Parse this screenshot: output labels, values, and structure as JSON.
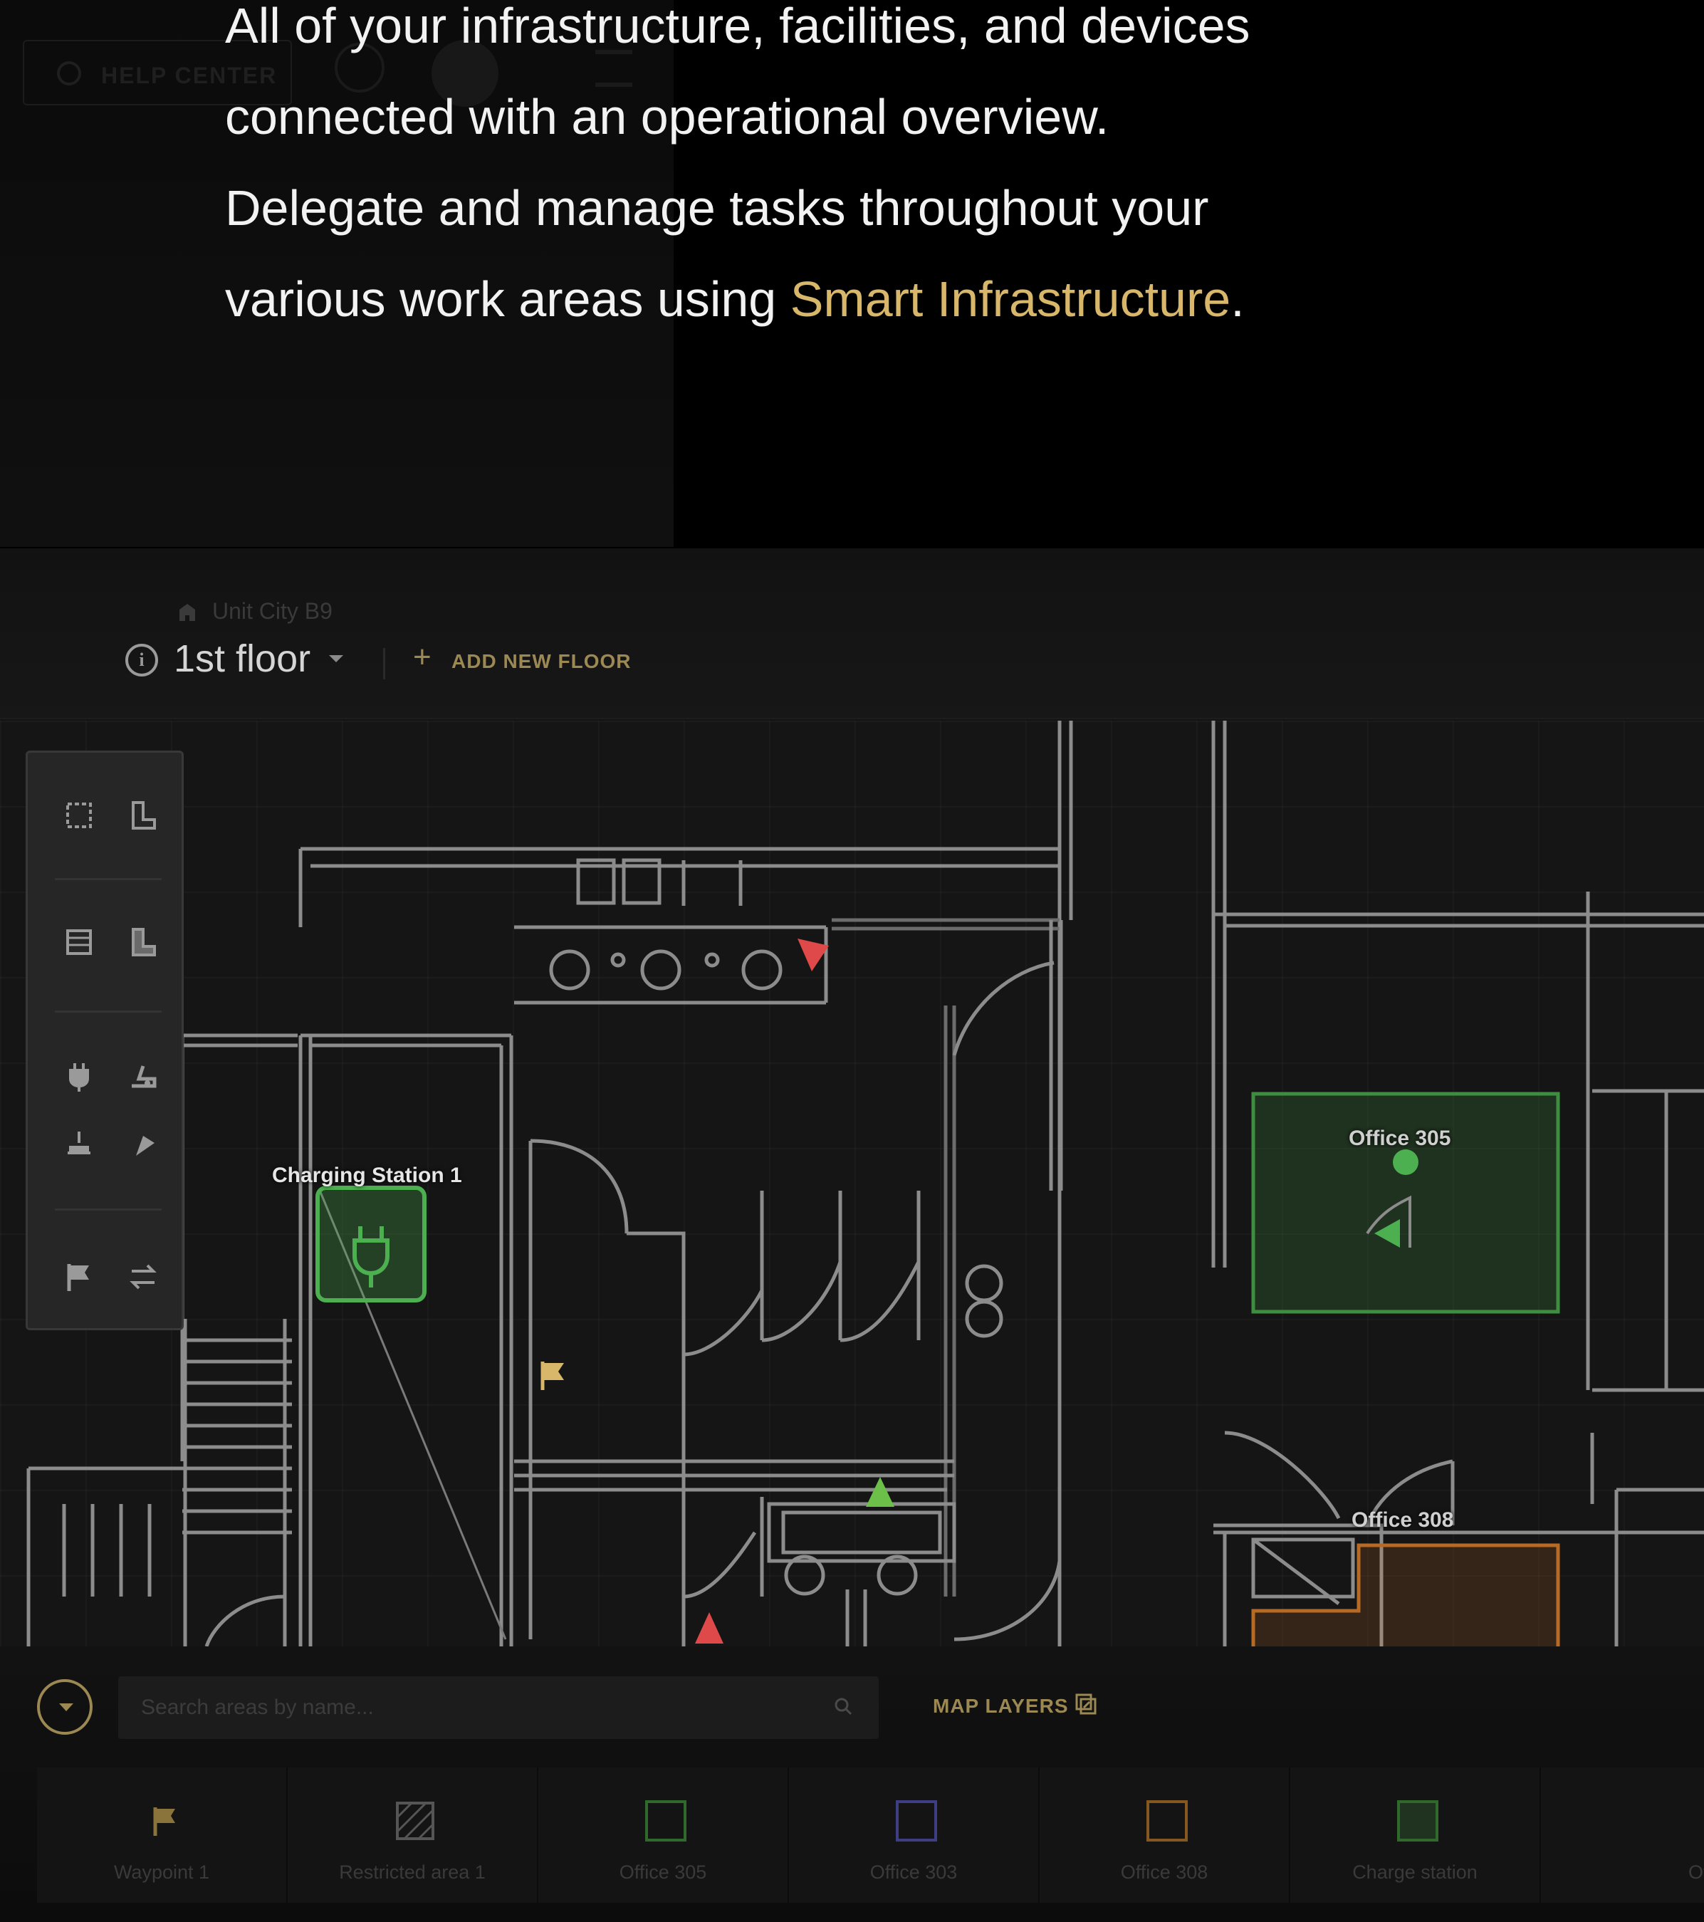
{
  "hero": {
    "line1": "All of your infrastructure, facilities, and devices",
    "line2": "connected with an operational overview.",
    "line3": "Delegate and manage tasks throughout your",
    "line4_prefix": "various work areas using ",
    "line4_accent": "Smart Infrastructure",
    "line4_suffix": "."
  },
  "ghost": {
    "help_center": "HELP CENTER"
  },
  "header": {
    "building": "Unit City B9",
    "floor": "1st floor",
    "add_floor": "ADD NEW FLOOR"
  },
  "map": {
    "labels": {
      "charging_station": "Charging Station 1",
      "office_305": "Office 305",
      "office_308": "Office 308"
    }
  },
  "toolbar": {
    "tools": [
      "rect-area-icon",
      "polygon-area-icon",
      "restricted-rect-icon",
      "restricted-polygon-icon",
      "charger-icon",
      "robot-icon",
      "dock-icon",
      "location-pin-icon",
      "waypoint-flag-icon",
      "route-swap-icon"
    ]
  },
  "bottom": {
    "search_placeholder": "Search areas by name...",
    "map_layers": "MAP LAYERS",
    "layers": [
      {
        "label": "Waypoint 1",
        "kind": "flag",
        "color": "#b89a4a"
      },
      {
        "label": "Restricted area 1",
        "kind": "hatch",
        "color": "#6a6a6a"
      },
      {
        "label": "Office 305",
        "kind": "square",
        "color": "#3c7a34"
      },
      {
        "label": "Office 303",
        "kind": "square",
        "color": "#4b4b9a"
      },
      {
        "label": "Office 308",
        "kind": "square",
        "color": "#9a6a2c"
      },
      {
        "label": "Charge station",
        "kind": "charger",
        "color": "#3c7a34"
      },
      {
        "label": "Office",
        "kind": "square",
        "color": "#8a2a2a"
      }
    ]
  },
  "colors": {
    "accent": "#d8b66a",
    "green": "#4caf50",
    "orange": "#d97c2b",
    "red": "#e0494a"
  }
}
